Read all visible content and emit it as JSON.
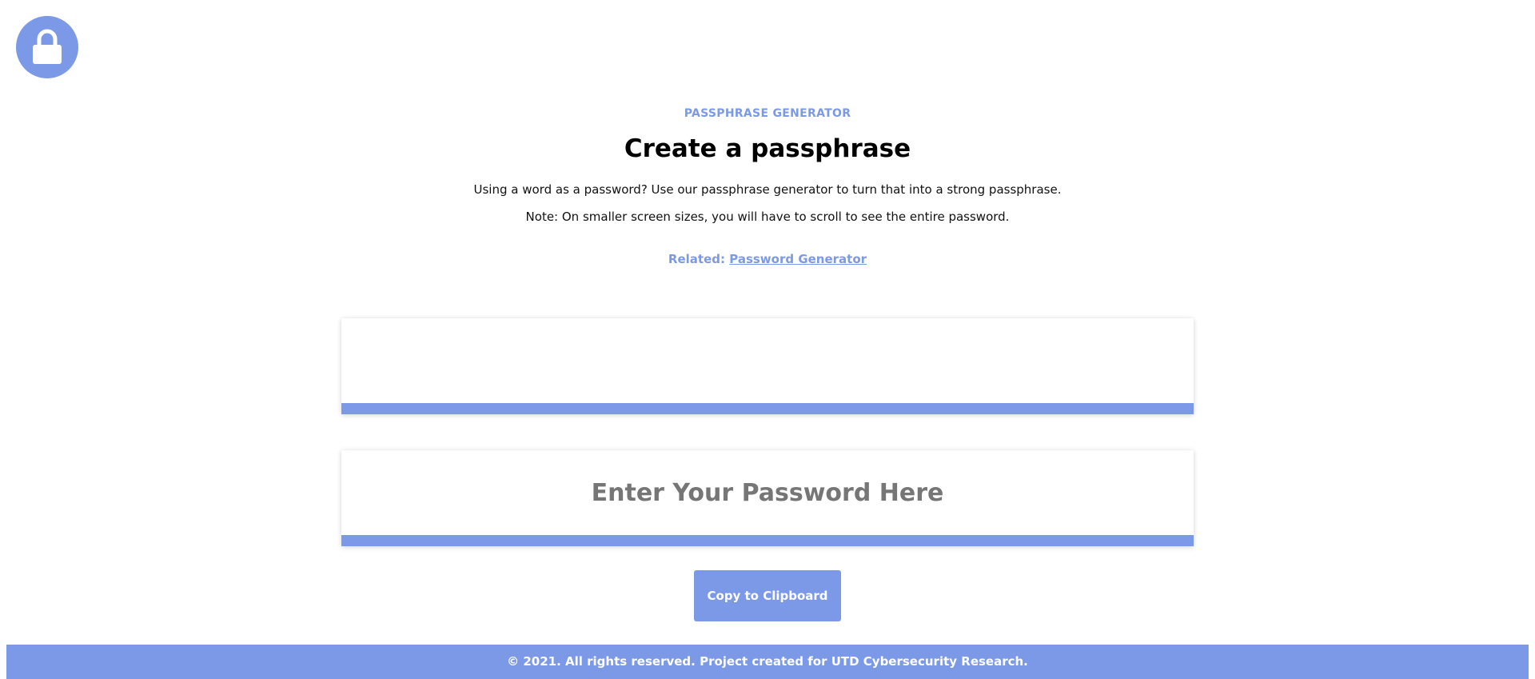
{
  "logo": {
    "icon": "lock-icon",
    "color": "#7b99e6"
  },
  "header": {
    "eyebrow": "PASSPHRASE GENERATOR",
    "title": "Create a passphrase",
    "description_1": "Using a word as a password? Use our passphrase generator to turn that into a strong passphrase.",
    "description_2": "Note: On smaller screen sizes, you will have to scroll to see the entire password.",
    "related_label": "Related:",
    "related_link": "Password Generator"
  },
  "output": {
    "value": ""
  },
  "input": {
    "value": "",
    "placeholder": "Enter Your Password Here"
  },
  "actions": {
    "copy_label": "Copy to Clipboard"
  },
  "footer": {
    "text": "© 2021. All rights reserved. Project created for UTD Cybersecurity Research."
  },
  "theme": {
    "accent": "#7b99e6"
  }
}
